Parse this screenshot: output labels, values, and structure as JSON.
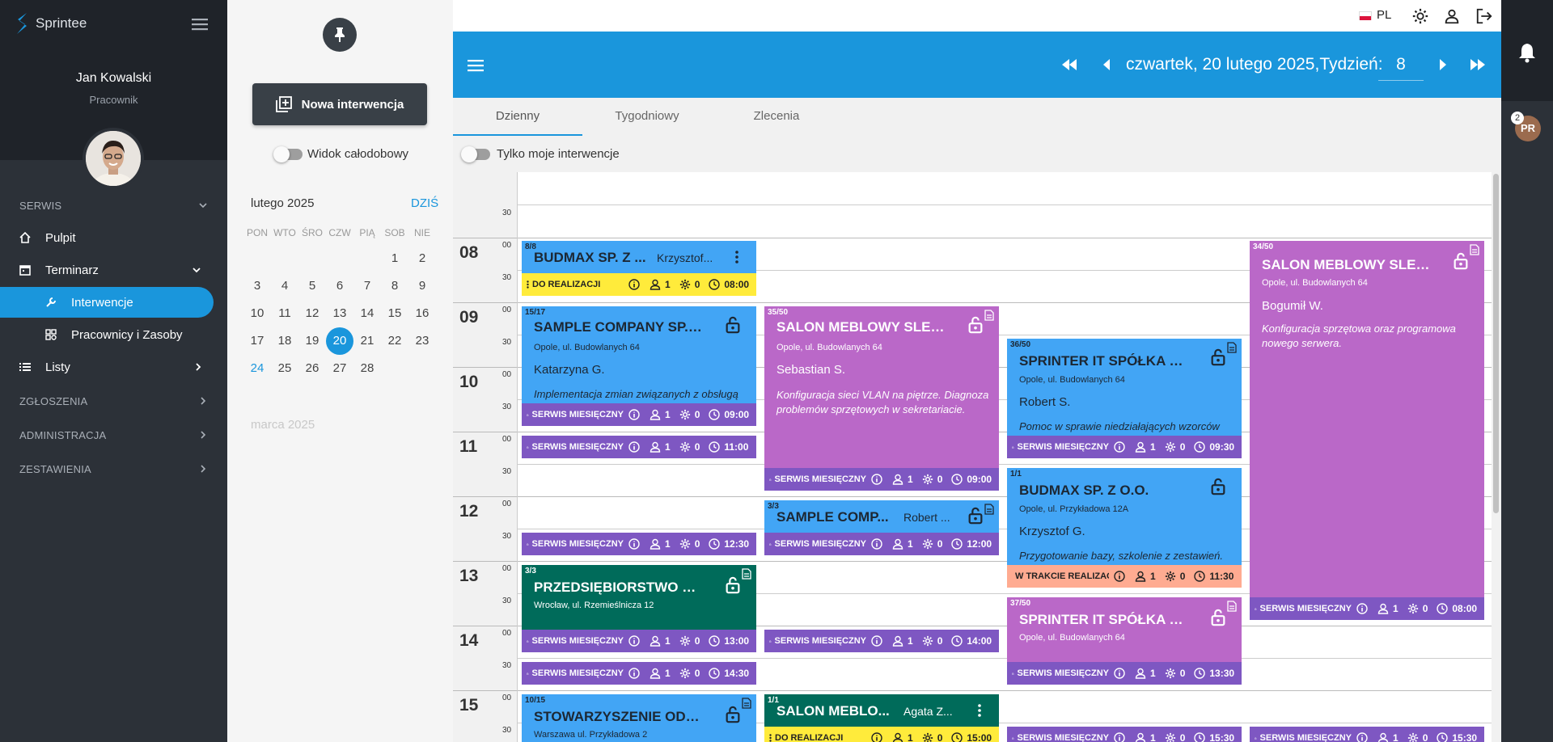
{
  "app": {
    "name": "Sprintee"
  },
  "user": {
    "name": "Jan Kowalski",
    "role": "Pracownik"
  },
  "nav": {
    "sections": [
      "SERWIS",
      "ZGŁOSZENIA",
      "ADMINISTRACJA",
      "ZESTAWIENIA"
    ],
    "items": {
      "pulpit": "Pulpit",
      "terminarz": "Terminarz",
      "interwencje": "Interwencje",
      "pracownicy": "Pracownicy i Zasoby",
      "listy": "Listy"
    }
  },
  "panel": {
    "new_button": "Nowa interwencja",
    "allday_label": "Widok całodobowy",
    "month_title": "lutego 2025",
    "today_label": "DZIŚ",
    "weekdays": [
      "PON",
      "WTO",
      "ŚRO",
      "CZW",
      "PIĄ",
      "SOB",
      "NIE"
    ],
    "next_month": "marca 2025",
    "days": [
      "1",
      "2",
      "3",
      "4",
      "5",
      "6",
      "7",
      "8",
      "9",
      "10",
      "11",
      "12",
      "13",
      "14",
      "15",
      "16",
      "17",
      "18",
      "19",
      "20",
      "21",
      "22",
      "23",
      "24",
      "25",
      "26",
      "27",
      "28"
    ],
    "selected_day": "20",
    "highlight_day": "24"
  },
  "topbar": {
    "lang": "PL"
  },
  "header": {
    "date_text": "czwartek, 20 lutego 2025,Tydzień:",
    "week": "8"
  },
  "tabs": [
    "Dzienny",
    "Tygodniowy",
    "Zlecenia"
  ],
  "filter": {
    "only_mine": "Tylko moje interwencje"
  },
  "notifications": {
    "avatar": "PR",
    "badge": "2"
  },
  "timeline": {
    "hours": [
      "08",
      "09",
      "10",
      "11",
      "12",
      "13",
      "14",
      "15"
    ],
    "minutes": [
      "00",
      "30"
    ]
  },
  "events": {
    "e1": {
      "count": "8/8",
      "title": "BUDMAX SP. Z ...",
      "who": "Krzysztof...",
      "status": "DO REALIZACJI",
      "a": "1",
      "b": "0",
      "time": "08:00"
    },
    "e2": {
      "count": "15/17",
      "title": "SAMPLE COMPANY SP. Z ...",
      "address": "Opole, ul. Budowlanych 64",
      "person": "Katarzyna G.",
      "desc": "Implementacja zmian związanych z obsługą",
      "status": "SERWIS MIESIĘCZNY",
      "a": "1",
      "b": "0",
      "time": "09:00"
    },
    "s3": {
      "status": "SERWIS MIESIĘCZNY",
      "a": "1",
      "b": "0",
      "time": "11:00"
    },
    "s4": {
      "status": "SERWIS MIESIĘCZNY",
      "a": "1",
      "b": "0",
      "time": "12:30"
    },
    "e5": {
      "count": "3/3",
      "title": "PRZEDSIĘBIORSTWO HA...",
      "address": "Wrocław, ul. Rzemieślnicza 12",
      "status": "SERWIS MIESIĘCZNY",
      "a": "1",
      "b": "0",
      "time": "13:00"
    },
    "s6": {
      "status": "SERWIS MIESIĘCZNY",
      "a": "1",
      "b": "0",
      "time": "14:30"
    },
    "e7": {
      "count": "10/15",
      "title": "STOWARZYSZENIE ODNO...",
      "address": "Warszawa ul. Przykładowa 2"
    },
    "e8": {
      "count": "35/50",
      "title": "SALON MEBLOWY SLEEP ...",
      "address": "Opole, ul. Budowlanych 64",
      "person": "Sebastian S.",
      "desc": "Konfiguracja sieci VLAN na piętrze. Diagnoza problemów sprzętowych w sekretariacie.",
      "status": "SERWIS MIESIĘCZNY",
      "a": "1",
      "b": "0",
      "time": "09:00"
    },
    "e9": {
      "count": "3/3",
      "title": "SAMPLE COMP...",
      "who": "Robert ...",
      "status": "SERWIS MIESIĘCZNY",
      "a": "1",
      "b": "0",
      "time": "12:00"
    },
    "s10": {
      "status": "SERWIS MIESIĘCZNY",
      "a": "1",
      "b": "0",
      "time": "14:00"
    },
    "e11": {
      "count": "1/1",
      "title": "SALON MEBLO...",
      "who": "Agata Z...",
      "status": "DO REALIZACJI",
      "a": "1",
      "b": "0",
      "time": "15:00"
    },
    "e12": {
      "count": "36/50",
      "title": "SPRINTER IT SPÓŁKA Z O...",
      "address": "Opole, ul. Budowlanych 64",
      "person": "Robert S.",
      "desc": "Pomoc w sprawie niedziałających wzorców",
      "status": "SERWIS MIESIĘCZNY",
      "a": "1",
      "b": "0",
      "time": "09:30"
    },
    "e13": {
      "count": "1/1",
      "title": "BUDMAX SP. Z O.O.",
      "address": "Opole, ul. Przykładowa 12A",
      "person": "Krzysztof G.",
      "desc": "Przygotowanie bazy, szkolenie z zestawień.",
      "status": "W TRAKCIE REALIZACJI",
      "a": "1",
      "b": "0",
      "time": "11:30"
    },
    "e14": {
      "count": "37/50",
      "title": "SPRINTER IT SPÓŁKA Z O...",
      "address": "Opole, ul. Budowlanych 64",
      "status": "SERWIS MIESIĘCZNY",
      "a": "1",
      "b": "0",
      "time": "13:30"
    },
    "s15": {
      "status": "SERWIS MIESIĘCZNY",
      "a": "1",
      "b": "0",
      "time": "15:30"
    },
    "e16": {
      "count": "34/50",
      "title": "SALON MEBLOWY SLEEP ...",
      "address": "Opole, ul. Budowlanych 64",
      "person": "Bogumił W.",
      "desc": "Konfiguracja sprzętowa oraz programowa nowego serwera.",
      "status": "SERWIS MIESIĘCZNY",
      "a": "1",
      "b": "0",
      "time": "08:00"
    },
    "s17": {
      "status": "SERWIS MIESIĘCZNY",
      "a": "1",
      "b": "0",
      "time": "15:30"
    }
  },
  "colors": {
    "brand": "#1a96dc",
    "sidebar": "#2c3138",
    "event_blue": "#42a5f5",
    "event_purple": "#ba68c8",
    "event_green": "#006b5a",
    "status_purple": "#7e57c2",
    "status_yellow": "#ffeb3b",
    "status_salmon": "#ffab91"
  }
}
